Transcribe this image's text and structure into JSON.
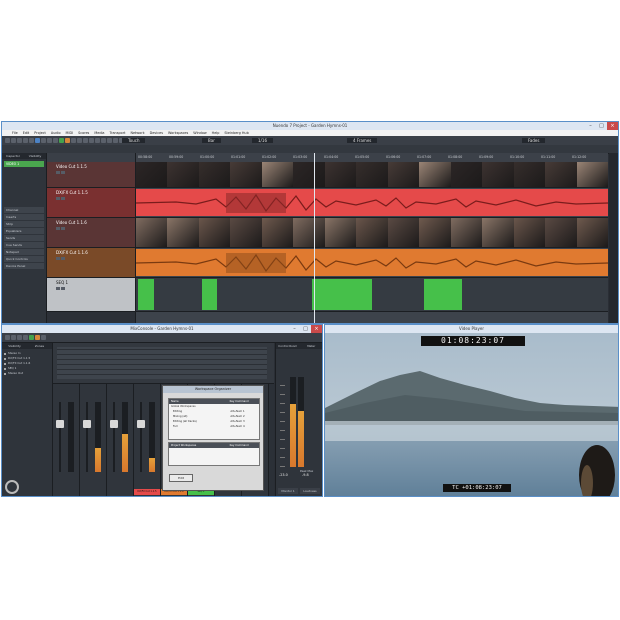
{
  "project_window": {
    "title": "Nuendo 7 Project - Garden Hymns-01",
    "app_name": "Nuendo 7",
    "menu": [
      "File",
      "Edit",
      "Project",
      "Audio",
      "MIDI",
      "Scores",
      "Media",
      "Transport",
      "Network",
      "Devices",
      "Workspaces",
      "Window",
      "Help",
      "Steinberg Hub"
    ],
    "toolbar": {
      "touch_mode": "Touch",
      "grid_label": "Bar",
      "quantize": "1/16",
      "nudge": "4 Frames",
      "fade": "Fades"
    },
    "inspector": {
      "tabs": [
        "Inspector",
        "Visibility"
      ],
      "track_label": "VIDEO 1",
      "sections": [
        "Channel",
        "Inserts",
        "Strip",
        "Equalizers",
        "Sends",
        "Cue Sends",
        "Notepad",
        "Quick Controls",
        "Device Panel"
      ]
    },
    "tracks": [
      {
        "name": "Video Cut 1.1.5",
        "kind": "video"
      },
      {
        "name": "DX/FX Cut 1.1.5",
        "kind": "audio_red"
      },
      {
        "name": "Video Cut 1.1.6",
        "kind": "video"
      },
      {
        "name": "DX/FX Cut 1.1.6",
        "kind": "audio_orange"
      },
      {
        "name": "SEQ 1",
        "kind": "audio_green"
      }
    ],
    "ruler_marks": [
      "00:58:00",
      "00:59:00",
      "01:00:00",
      "01:01:00",
      "01:02:00",
      "01:03:00",
      "01:04:00",
      "01:05:00",
      "01:06:00",
      "01:07:00",
      "01:08:00",
      "01:09:00",
      "01:10:00",
      "01:11:00",
      "01:12:00"
    ]
  },
  "mixconsole_window": {
    "title": "MixConsole - Garden Hymns-01",
    "left_panel_tabs": [
      "Visibility",
      "Zones"
    ],
    "channel_list": [
      "Stereo In",
      "DX/FX Cut 1.1.5",
      "DX/FX Cut 1.1.6",
      "SEQ 1",
      "Stereo Out"
    ],
    "channel_names": [
      "DX/FX Cut 1.1.5",
      "DX/FX Cut 1.1.6",
      "SEQ 1"
    ],
    "control_room": {
      "header_tabs": [
        "Control Room",
        "Meter"
      ],
      "monitor_label": "Monitor 1",
      "loudness_label": "Loudness"
    },
    "loudness": {
      "integrated": "-23.0",
      "peak_label": "Peak Max",
      "peak_value": "-9.8"
    }
  },
  "workspace_organizer": {
    "title": "Workspace Organizer",
    "sections": [
      "Global Workspaces",
      "Project Workspaces"
    ],
    "items": [
      {
        "name": "Editing",
        "shortcut": "Alt+Num 1"
      },
      {
        "name": "Mixing (all)",
        "shortcut": "Alt+Num 2"
      },
      {
        "name": "Editing (all tracks)",
        "shortcut": "Alt+Num 3"
      },
      {
        "name": "Full",
        "shortcut": "Alt+Num 4"
      }
    ],
    "columns": [
      "Name",
      "Key Command"
    ],
    "ok_label": "Edit"
  },
  "video_player": {
    "title": "Video Player",
    "timecode_top": "01:08:23:07",
    "timecode_bottom": "TC +01:08:23:07"
  },
  "colors": {
    "video_track": "#6b3a3a",
    "audio_red": "#e54a4a",
    "audio_orange": "#e07a30",
    "audio_green": "#46c04a",
    "panel_bg": "#2a2e35",
    "accent": "#5a8fc8"
  }
}
